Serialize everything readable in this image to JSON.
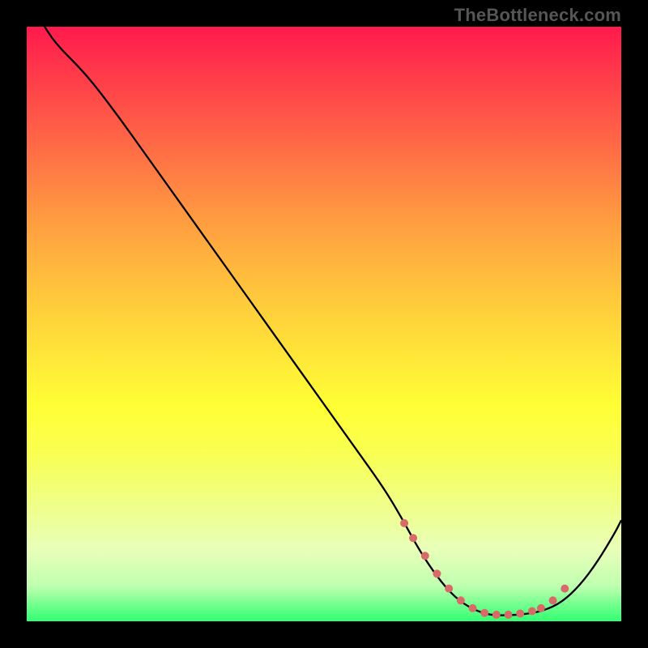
{
  "watermark": "TheBottleneck.com",
  "chart_data": {
    "type": "line",
    "title": "",
    "xlabel": "",
    "ylabel": "",
    "xlim": [
      0,
      100
    ],
    "ylim": [
      0,
      100
    ],
    "grid": false,
    "legend": false,
    "series": [
      {
        "name": "curve",
        "x": [
          3,
          5,
          10,
          15,
          20,
          25,
          30,
          35,
          40,
          45,
          50,
          55,
          60,
          63,
          66,
          69,
          72,
          75,
          78,
          81,
          84,
          87,
          90,
          93,
          96,
          99,
          100
        ],
        "y": [
          100,
          97,
          92,
          85.5,
          78.5,
          71.5,
          64.5,
          57.5,
          50.5,
          43.5,
          36.5,
          29.5,
          22.5,
          17.5,
          12,
          7.5,
          4,
          2,
          1,
          1,
          1.2,
          1.8,
          3.2,
          6,
          10,
          15,
          17
        ]
      }
    ],
    "markers": {
      "name": "highlight-points",
      "color": "#d86a6a",
      "x": [
        63.5,
        65,
        67,
        69,
        71,
        73,
        75,
        77,
        79,
        81,
        83,
        85,
        86.5,
        88.5,
        90.5
      ],
      "y": [
        16.5,
        14,
        11,
        8,
        5.5,
        3.5,
        2.2,
        1.4,
        1.1,
        1.1,
        1.3,
        1.7,
        2.2,
        3.5,
        5.5
      ]
    }
  }
}
